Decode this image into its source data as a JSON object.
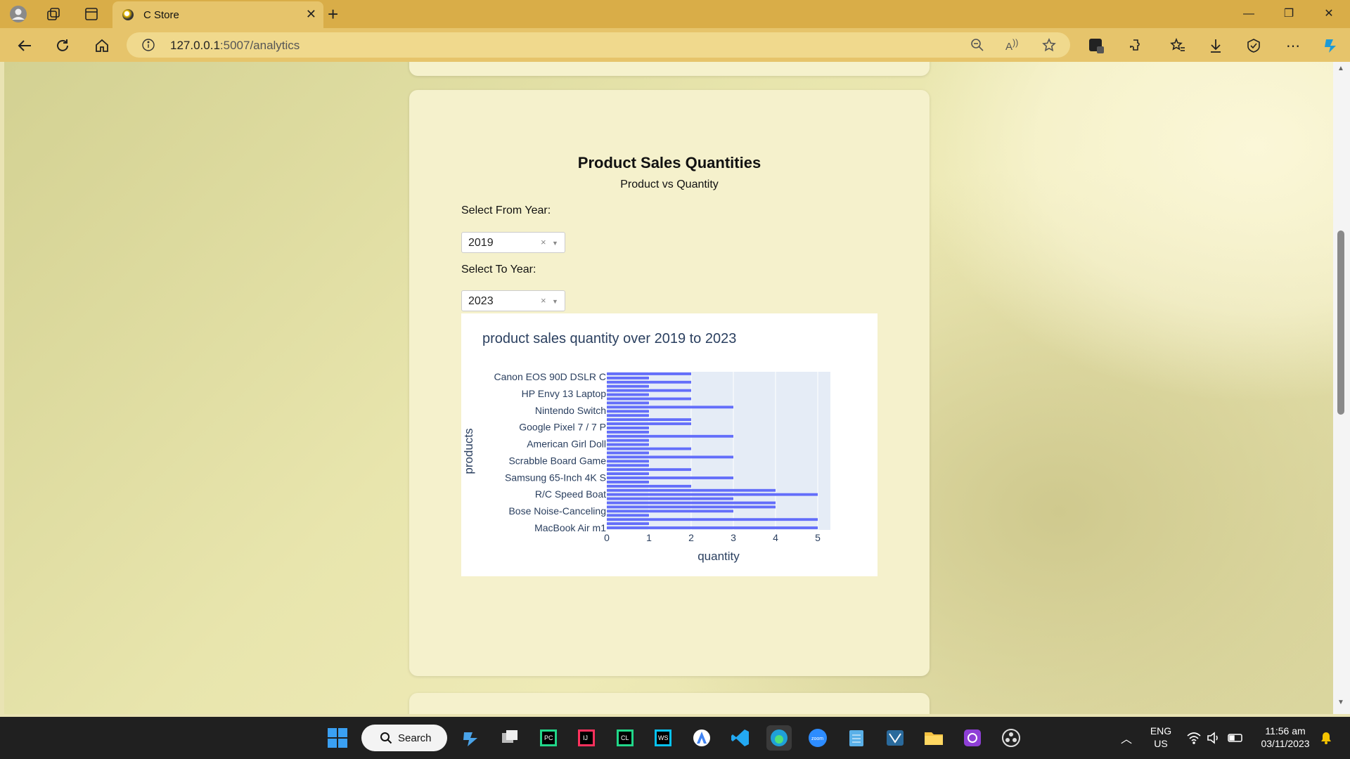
{
  "browser": {
    "tab_title": "C Store",
    "url_host": "127.0.0.1",
    "url_rest": ":5007/analytics",
    "accent": "#d9ad48"
  },
  "page": {
    "title": "Product Sales Quantities",
    "subtitle": "Product vs Quantity",
    "from_label": "Select From Year:",
    "from_value": "2019",
    "to_label": "Select To Year:",
    "to_value": "2023",
    "clear_glyph": "×"
  },
  "chart_data": {
    "type": "bar",
    "orientation": "horizontal",
    "title": "product sales quantity over 2019 to 2023",
    "xlabel": "quantity",
    "ylabel": "products",
    "xlim": [
      0,
      5.3
    ],
    "xticks": [
      0,
      1,
      2,
      3,
      4,
      5
    ],
    "ytick_labels": [
      "Canon EOS 90D DSLR C",
      "HP Envy 13 Laptop",
      "Nintendo Switch",
      "Google Pixel 7 / 7 P",
      "American Girl Doll",
      "Scrabble Board Game",
      "Samsung 65-Inch 4K S",
      "R/C Speed Boat",
      "Bose Noise-Canceling",
      "MacBook Air m1"
    ],
    "values": [
      2,
      1,
      2,
      1,
      2,
      1,
      2,
      1,
      3,
      1,
      1,
      2,
      2,
      1,
      1,
      3,
      1,
      1,
      2,
      1,
      3,
      1,
      1,
      2,
      1,
      3,
      1,
      2,
      4,
      5,
      3,
      4,
      4,
      3,
      1,
      5,
      1,
      5
    ],
    "bar_color": "#636efa",
    "plot_bg": "#e5ecf6",
    "grid": true
  },
  "taskbar": {
    "search_label": "Search",
    "lang_top": "ENG",
    "lang_bottom": "US",
    "time": "11:56 am",
    "date": "03/11/2023"
  }
}
